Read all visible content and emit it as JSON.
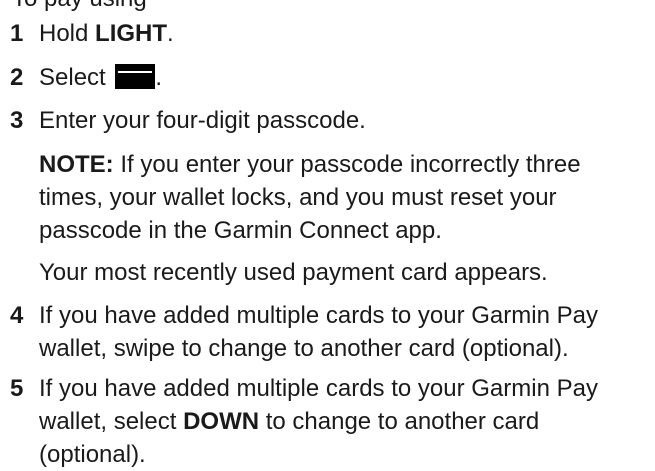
{
  "clipped_intro": "To pay using",
  "steps": [
    {
      "num": "1",
      "pre": "Hold ",
      "bold": "LIGHT",
      "post": "."
    },
    {
      "num": "2",
      "pre": "Select ",
      "icon": "payment-card-icon",
      "post": "."
    },
    {
      "num": "3",
      "text": "Enter your four-digit passcode."
    },
    {
      "num": "4",
      "text": "If you have added multiple cards to your Garmin Pay wallet, swipe to change to another card (optional)."
    },
    {
      "num": "5",
      "pre": "If you have added multiple cards to your Garmin Pay wallet, select ",
      "bold": "DOWN",
      "post": " to change to another card (optional)."
    }
  ],
  "note": {
    "label": "NOTE:",
    "text": " If you enter your passcode incorrectly three times, your wallet locks, and you must reset your passcode in the Garmin Connect app."
  },
  "result_text": "Your most recently used payment card appears."
}
